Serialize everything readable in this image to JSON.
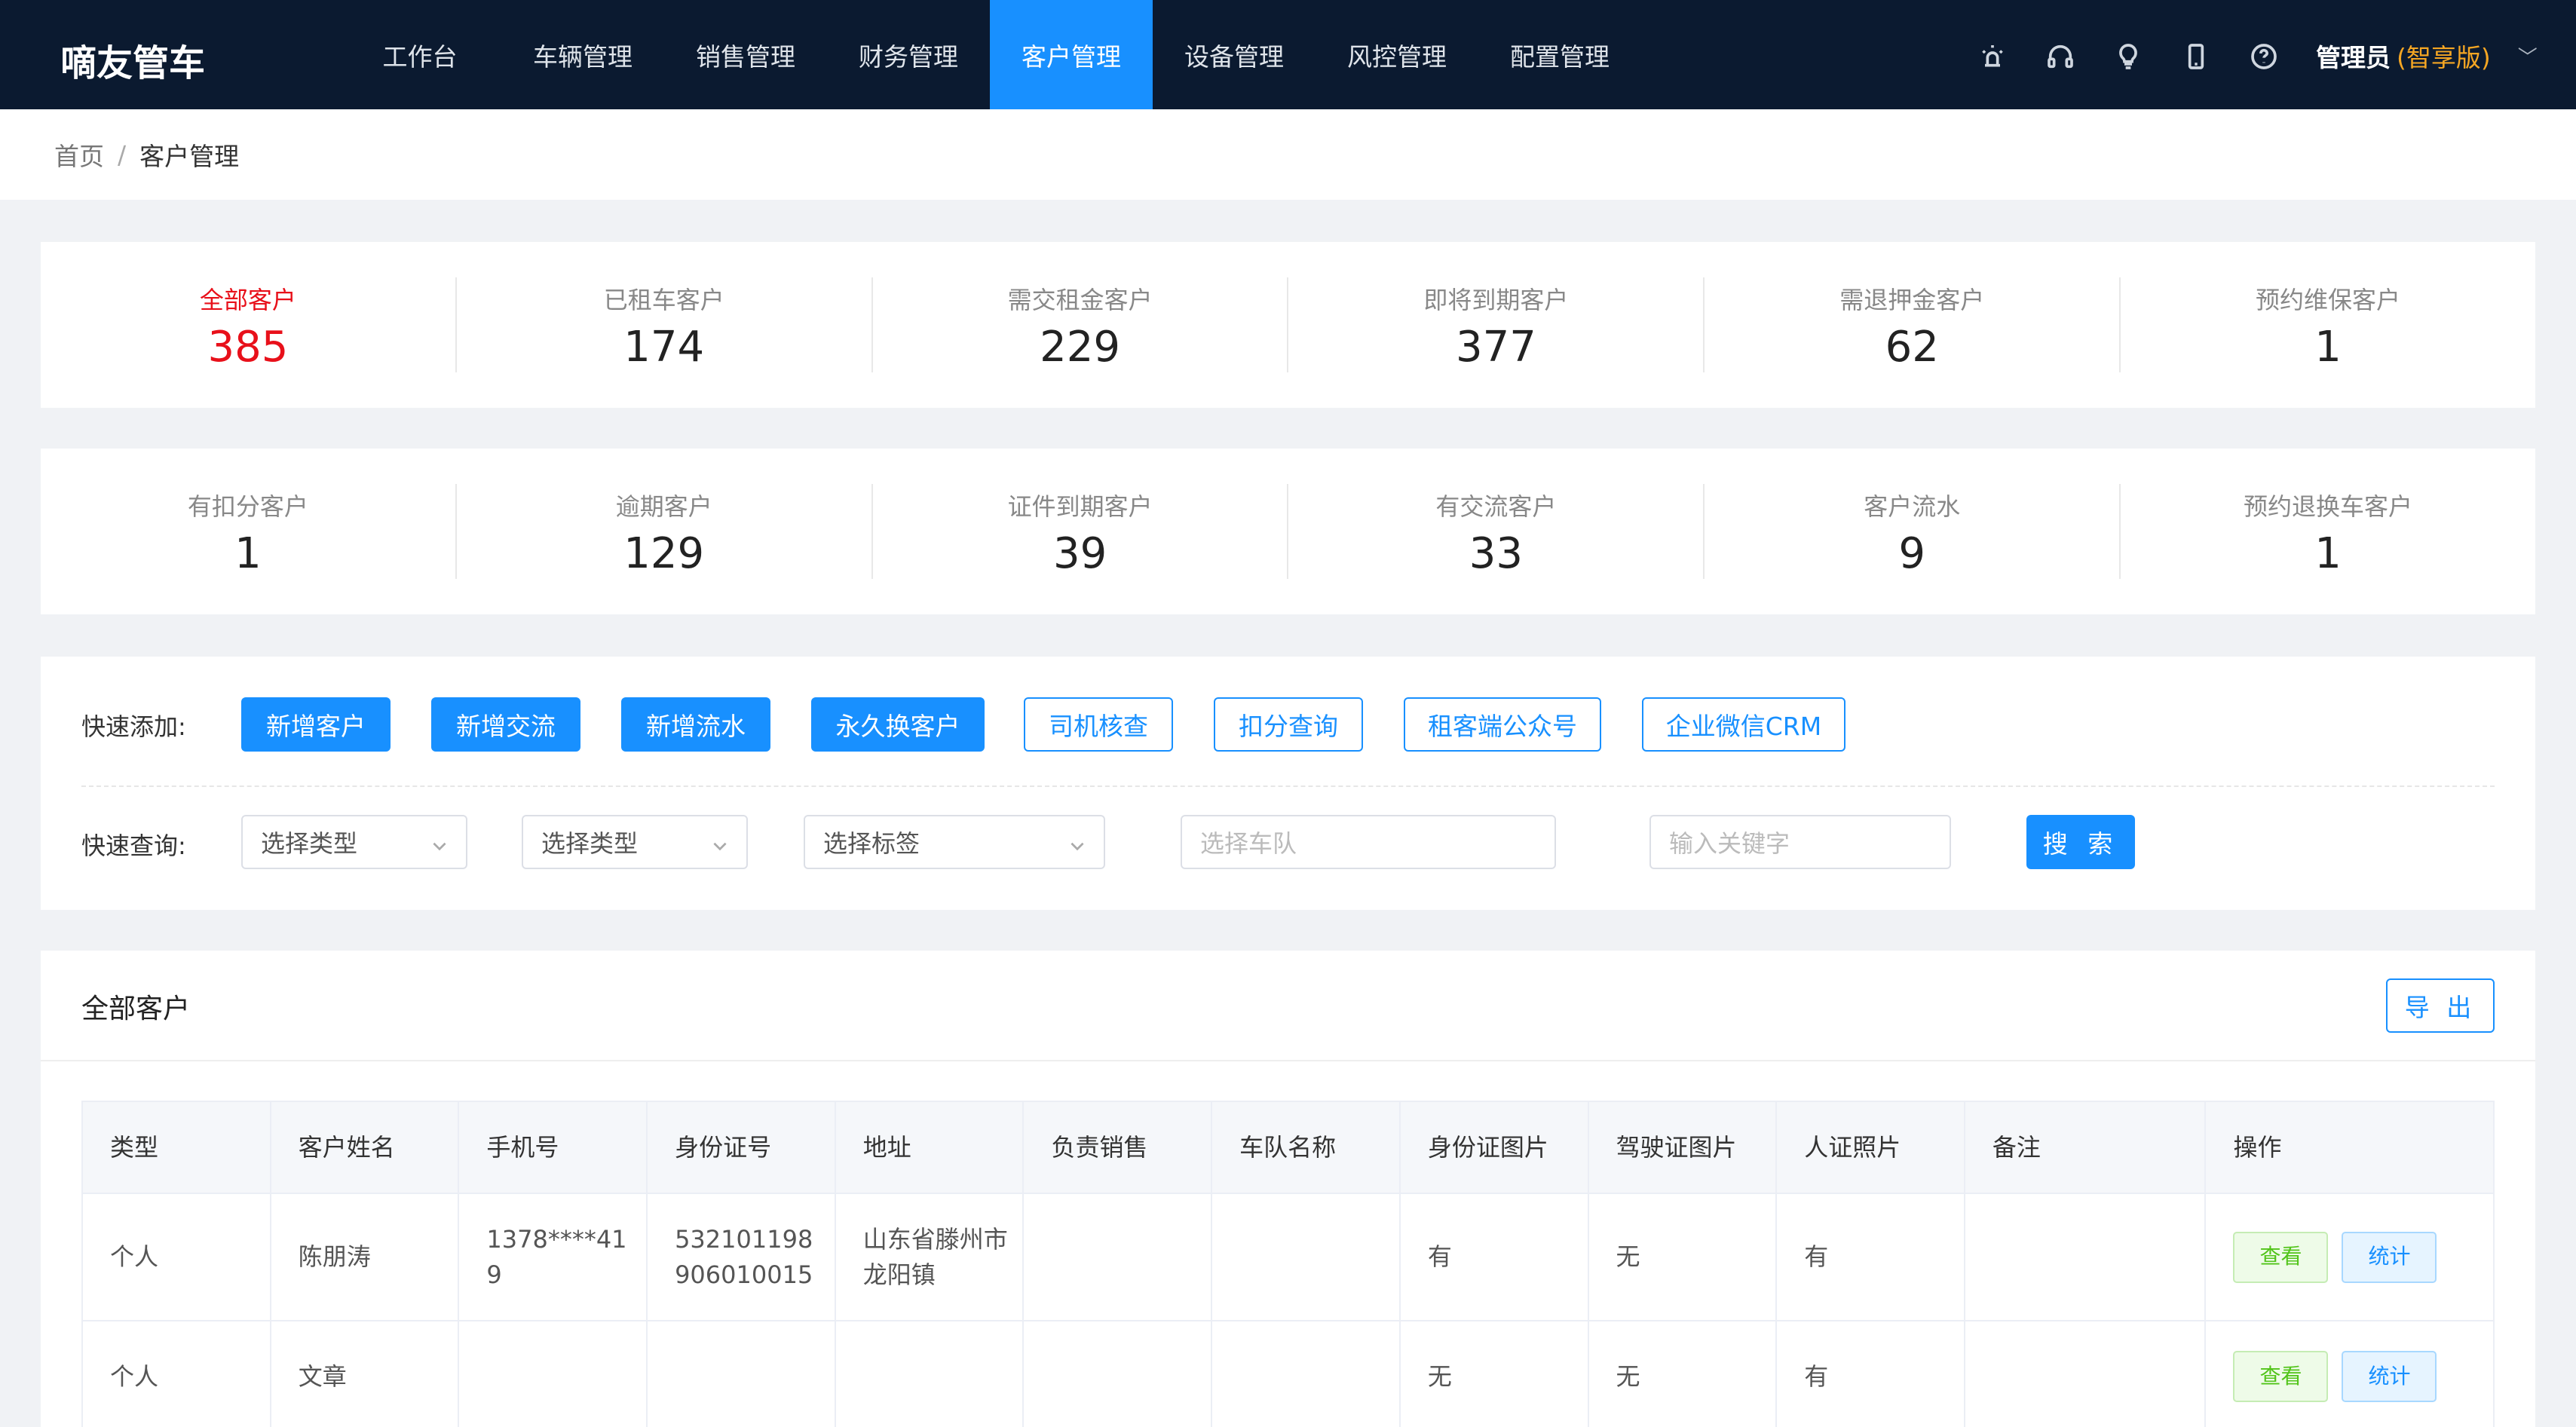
{
  "app": {
    "logo": "嘀友管车",
    "nav": [
      {
        "label": "工作台"
      },
      {
        "label": "车辆管理"
      },
      {
        "label": "销售管理"
      },
      {
        "label": "财务管理"
      },
      {
        "label": "客户管理",
        "active": true
      },
      {
        "label": "设备管理"
      },
      {
        "label": "风控管理"
      },
      {
        "label": "配置管理"
      }
    ],
    "header_icons": [
      "alarm-icon",
      "headset-icon",
      "lightbulb-icon",
      "mobile-icon",
      "help-icon"
    ],
    "user": {
      "name": "管理员",
      "edition": "(智享版)"
    }
  },
  "breadcrumb": {
    "home": "首页",
    "separator": "/",
    "current": "客户管理"
  },
  "stats_row1": [
    {
      "label": "全部客户",
      "value": "385",
      "active": true
    },
    {
      "label": "已租车客户",
      "value": "174"
    },
    {
      "label": "需交租金客户",
      "value": "229"
    },
    {
      "label": "即将到期客户",
      "value": "377"
    },
    {
      "label": "需退押金客户",
      "value": "62"
    },
    {
      "label": "预约维保客户",
      "value": "1"
    }
  ],
  "stats_row2": [
    {
      "label": "有扣分客户",
      "value": "1"
    },
    {
      "label": "逾期客户",
      "value": "129"
    },
    {
      "label": "证件到期客户",
      "value": "39"
    },
    {
      "label": "有交流客户",
      "value": "33"
    },
    {
      "label": "客户流水",
      "value": "9"
    },
    {
      "label": "预约退换车客户",
      "value": "1"
    }
  ],
  "quick_add": {
    "label": "快速添加:",
    "buttons": [
      "新增客户",
      "新增交流",
      "新增流水",
      "永久换客户",
      "司机核查",
      "扣分查询",
      "租客端公众号",
      "企业微信CRM"
    ]
  },
  "quick_search": {
    "label": "快速查询:",
    "select1": "选择类型",
    "select2": "选择类型",
    "select3": "选择标签",
    "fleet_placeholder": "选择车队",
    "keyword_placeholder": "输入关键字",
    "search_button": "搜 索"
  },
  "table": {
    "title": "全部客户",
    "export_button": "导 出",
    "columns": [
      "类型",
      "客户姓名",
      "手机号",
      "身份证号",
      "地址",
      "负责销售",
      "车队名称",
      "身份证图片",
      "驾驶证图片",
      "人证照片",
      "备注",
      "操作"
    ],
    "rows": [
      {
        "type": "个人",
        "name": "陈朋涛",
        "phone": "1378****419",
        "id_number": "532101198906010015",
        "address": "山东省滕州市龙阳镇",
        "sales": "",
        "fleet": "",
        "id_photo": "有",
        "license_photo": "无",
        "person_photo": "有",
        "remark": ""
      },
      {
        "type": "个人",
        "name": "文章",
        "phone": "",
        "id_number": "",
        "address": "",
        "sales": "",
        "fleet": "",
        "id_photo": "无",
        "license_photo": "无",
        "person_photo": "有",
        "remark": ""
      }
    ],
    "row_actions": {
      "view": "查看",
      "stats": "统计"
    }
  },
  "colors": {
    "header_bg": "#0b1a30",
    "accent": "#1890ff",
    "highlight": "#e8101a",
    "edition": "#f5a623"
  }
}
